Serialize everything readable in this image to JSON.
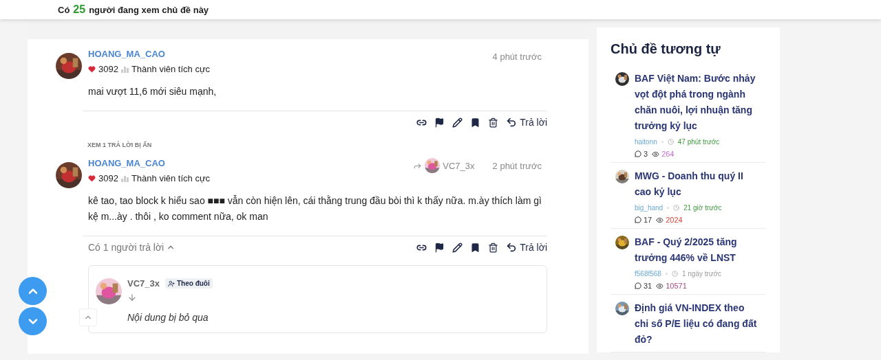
{
  "viewer_banner": {
    "prefix": "Có",
    "count": "25",
    "suffix": "người đang xem chủ đề này"
  },
  "thread": [
    {
      "kind": "post",
      "author": "HOANG_MA_CAO",
      "likes": "3092",
      "rank": "Thành viên tích cực",
      "time": "4 phút trước",
      "body": [
        "mai vượt 11,6 mới siêu mạnh,"
      ],
      "reply_label": "Trả lời"
    },
    {
      "kind": "hidden_notice",
      "text": "XEM 1 TRẢ LỜI BỊ ẨN"
    },
    {
      "kind": "post",
      "author": "HOANG_MA_CAO",
      "likes": "3092",
      "rank": "Thành viên tích cực",
      "via": "VC7_3x",
      "time": "2 phút trước",
      "body": [
        "kê tao, tao block k hiểu sao ■■■ vẫn còn hiện lên, cái thằng trung đầu bòi thì k thấy nữa. m.ày thích làm gì kệ m...ày . thôi , ko comment nữa, ok man"
      ],
      "replies_label": "Có 1 người trả lời",
      "expanded": true,
      "reply_label": "Trả lời",
      "reply_card": {
        "author": "VC7_3x",
        "follow_label": "Theo đuôi",
        "body": "Nội dung bị bỏ qua"
      }
    }
  ],
  "sidebar": {
    "title": "Chủ đề tương tự",
    "topics": [
      {
        "title": "BAF Việt Nam: Bước nhảy vọt đột phá trong ngành chăn nuôi, lợi nhuận tăng trưởng kỷ lục",
        "author": "haitonn",
        "time": {
          "text": "47 phút trước",
          "color": "#3f9a3c"
        },
        "comments": "3",
        "views": {
          "text": "264",
          "color": "#c46fd0"
        }
      },
      {
        "title": "MWG - Doanh thu quý II cao kỷ lục",
        "author": "big_hand",
        "time": {
          "text": "21 giờ trước",
          "color": "#3f9a3c"
        },
        "comments": "17",
        "views": {
          "text": "2024",
          "color": "#d8433a"
        }
      },
      {
        "title": "BAF - Quý 2/2025 tăng trưởng 446% về LNST",
        "author": "f568f568",
        "time": {
          "text": "1 ngày trước",
          "color": "#9a9a9a"
        },
        "comments": "31",
        "views": {
          "text": "10571",
          "color": "#a34a80"
        }
      },
      {
        "title": "Định giá VN-INDEX theo chỉ số P/E liệu có đang đất đỏ?"
      }
    ]
  }
}
